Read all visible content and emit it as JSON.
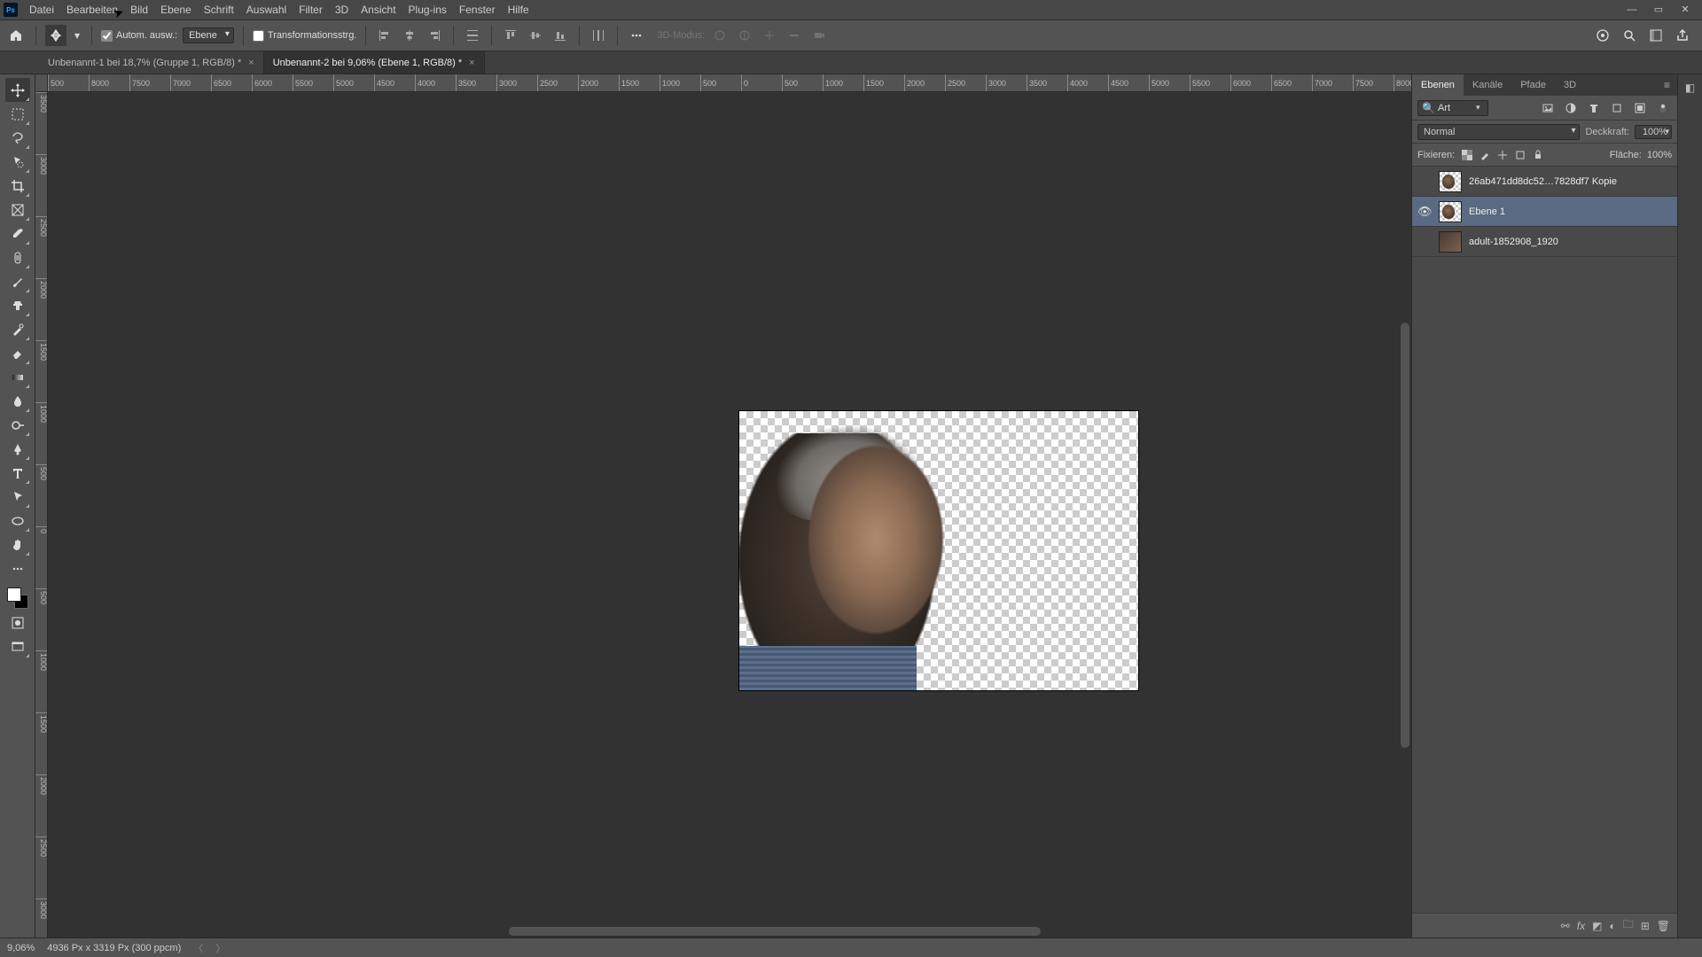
{
  "menu": {
    "items": [
      "Datei",
      "Bearbeiten",
      "Bild",
      "Ebene",
      "Schrift",
      "Auswahl",
      "Filter",
      "3D",
      "Ansicht",
      "Plug-ins",
      "Fenster",
      "Hilfe"
    ]
  },
  "options": {
    "auto_select_label": "Autom. ausw.:",
    "auto_select_checked": true,
    "target_select": "Ebene",
    "transform_label": "Transformationsstrg.",
    "transform_checked": false,
    "mode3d_label": "3D-Modus:"
  },
  "doc_tabs": [
    {
      "title": "Unbenannt-1 bei 18,7% (Gruppe 1, RGB/8) *",
      "active": false
    },
    {
      "title": "Unbenannt-2 bei 9,06% (Ebene 1, RGB/8) *",
      "active": true
    }
  ],
  "ruler_h": [
    "500",
    "8000",
    "7500",
    "7000",
    "6500",
    "6000",
    "5500",
    "5000",
    "4500",
    "4000",
    "3500",
    "3000",
    "2500",
    "2000",
    "1500",
    "1000",
    "500",
    "0",
    "500",
    "1000",
    "1500",
    "2000",
    "2500",
    "3000",
    "3500",
    "4000",
    "4500",
    "5000",
    "5500",
    "6000",
    "6500",
    "7000",
    "7500",
    "8000"
  ],
  "ruler_v": [
    "3500",
    "3000",
    "2500",
    "2000",
    "1500",
    "1000",
    "500",
    "0",
    "500",
    "1000",
    "1500",
    "2000",
    "2500",
    "3000"
  ],
  "panels": {
    "tabs": [
      "Ebenen",
      "Kanäle",
      "Pfade",
      "3D"
    ],
    "active_tab": 0,
    "filter_label": "Art",
    "blend_mode": "Normal",
    "opacity_label": "Deckkraft:",
    "opacity_value": "100%",
    "lock_label": "Fixieren:",
    "fill_label": "Fläche:",
    "fill_value": "100%"
  },
  "layers": [
    {
      "visible": false,
      "name": "26ab471dd8dc52…7828df7 Kopie",
      "selected": false
    },
    {
      "visible": true,
      "name": "Ebene 1",
      "selected": true
    },
    {
      "visible": false,
      "name": "adult-1852908_1920",
      "selected": false
    }
  ],
  "status": {
    "zoom": "9,06%",
    "dimensions": "4936 Px x 3319 Px (300 ppcm)"
  }
}
